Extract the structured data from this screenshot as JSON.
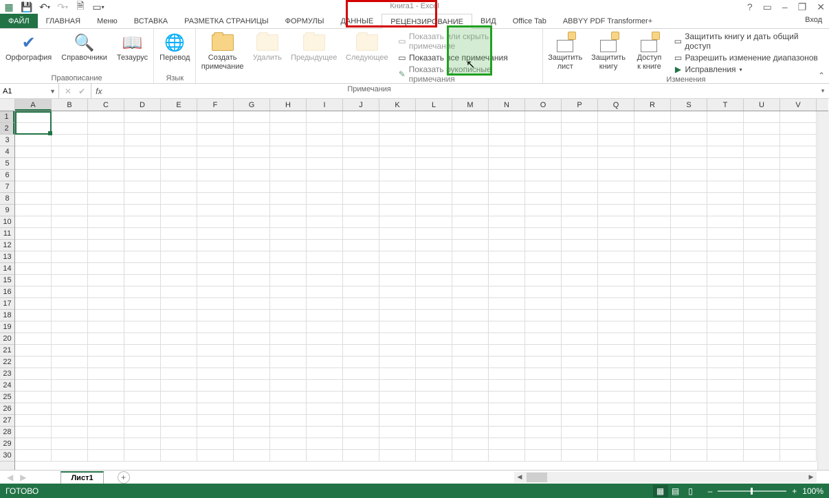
{
  "titlebar": {
    "title": "Книга1 - Excel"
  },
  "window_controls": {
    "help": "?",
    "ribbon_opts": "▭",
    "min": "–",
    "restore": "❐",
    "close": "✕"
  },
  "tabs": {
    "file": "ФАЙЛ",
    "items": [
      "ГЛАВНАЯ",
      "Меню",
      "ВСТАВКА",
      "РАЗМЕТКА СТРАНИЦЫ",
      "ФОРМУЛЫ",
      "ДАННЫЕ",
      "РЕЦЕНЗИРОВАНИЕ",
      "ВИД",
      "Office Tab",
      "ABBYY PDF Transformer+"
    ],
    "active_index": 6,
    "login": "Вход"
  },
  "ribbon": {
    "group_proofing": {
      "label": "Правописание",
      "spelling": "Орфография",
      "research": "Справочники",
      "thesaurus": "Тезаурус"
    },
    "group_language": {
      "label": "Язык",
      "translate": "Перевод"
    },
    "group_comments": {
      "label": "Примечания",
      "new": "Создать\nпримечание",
      "delete": "Удалить",
      "previous": "Предыдущее",
      "next": "Следующее",
      "show_hide": "Показать или скрыть примечание",
      "show_all": "Показать все примечания",
      "show_ink": "Показать рукописные примечания"
    },
    "group_changes": {
      "label": "Изменения",
      "protect_sheet": "Защитить\nлист",
      "protect_book": "Защитить\nкнигу",
      "share_book": "Доступ\nк книге",
      "protect_share": "Защитить книгу и дать общий доступ",
      "allow_ranges": "Разрешить изменение диапазонов",
      "track_changes": "Исправления"
    }
  },
  "namebox": {
    "value": "A1"
  },
  "formula_bar": {
    "fx": "fx",
    "value": ""
  },
  "columns": [
    "A",
    "B",
    "C",
    "D",
    "E",
    "F",
    "G",
    "H",
    "I",
    "J",
    "K",
    "L",
    "M",
    "N",
    "O",
    "P",
    "Q",
    "R",
    "S",
    "T",
    "U",
    "V"
  ],
  "rows_count": 30,
  "selected_cell": "A1",
  "sheets": {
    "active": "Лист1"
  },
  "status": {
    "ready": "ГОТОВО",
    "zoom": "100%"
  }
}
